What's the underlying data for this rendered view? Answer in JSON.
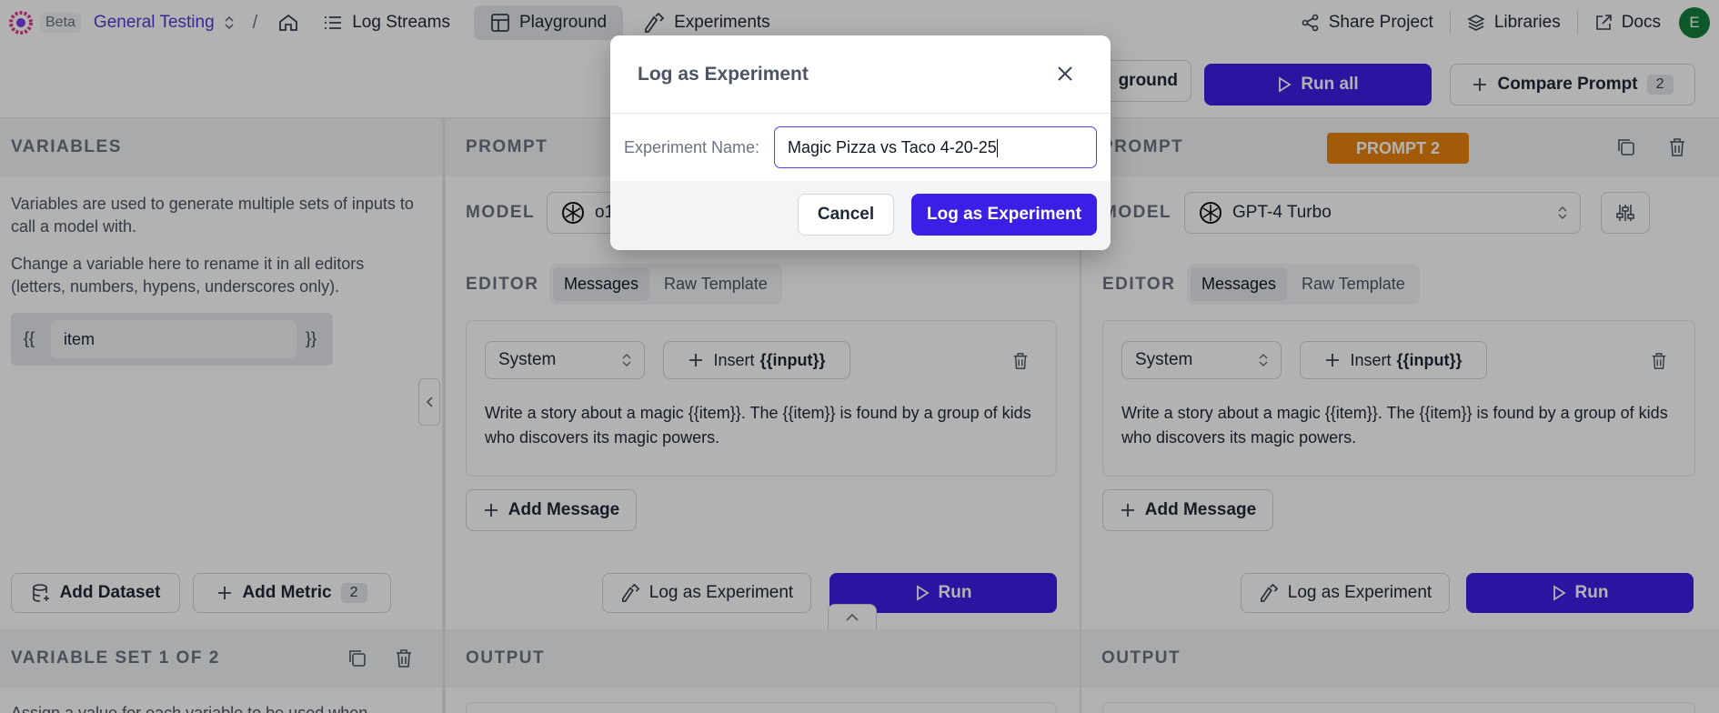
{
  "topbar": {
    "beta": "Beta",
    "project": "General Testing",
    "slash": "/",
    "nav": [
      {
        "label": "Log Streams"
      },
      {
        "label": "Playground"
      },
      {
        "label": "Experiments"
      }
    ],
    "share": "Share Project",
    "libraries": "Libraries",
    "docs": "Docs",
    "avatar": "E"
  },
  "toolbar": {
    "clear_partial": "ground",
    "run_all": "Run all",
    "compare_prompt": "Compare Prompt",
    "compare_count": "2"
  },
  "variables": {
    "header": "VARIABLES",
    "help1": "Variables are used to generate multiple sets of inputs to call a model with.",
    "help2": "Change a variable here to rename it in all editors (letters, numbers, hypens, underscores only).",
    "open": "{{",
    "close": "}}",
    "variable_value": "item",
    "add_dataset": "Add Dataset",
    "add_metric": "Add Metric",
    "metric_count": "2",
    "set_header": "VARIABLE SET 1 OF 2",
    "set_help": "Assign a value for each variable to be used when"
  },
  "prompt1": {
    "header": "PROMPT",
    "model_label": "MODEL",
    "model_value": "o1",
    "editor_label": "EDITOR",
    "tab_messages": "Messages",
    "tab_raw": "Raw Template",
    "role": "System",
    "insert": "Insert",
    "insert_token": "{{input}}",
    "text": "Write a story about a magic {{item}}. The {{item}} is found by a group of kids who discovers its magic powers.",
    "add_message": "Add Message",
    "log_experiment": "Log as Experiment",
    "run": "Run",
    "output_header": "OUTPUT"
  },
  "prompt2": {
    "header": "PROMPT",
    "badge": "PROMPT 2",
    "model_label": "MODEL",
    "model_value": "GPT-4 Turbo",
    "editor_label": "EDITOR",
    "tab_messages": "Messages",
    "tab_raw": "Raw Template",
    "role": "System",
    "insert": "Insert",
    "insert_token": "{{input}}",
    "text": "Write a story about a magic {{item}}. The {{item}} is found by a group of kids who discovers its magic powers.",
    "add_message": "Add Message",
    "log_experiment": "Log as Experiment",
    "run": "Run",
    "output_header": "OUTPUT"
  },
  "modal": {
    "title": "Log as Experiment",
    "field_label": "Experiment Name:",
    "field_value": "Magic Pizza vs Taco 4-20-25",
    "cancel": "Cancel",
    "submit": "Log as Experiment"
  },
  "colors": {
    "primary": "#3b1fe6",
    "project_link": "#4f3bd6",
    "badge_orange": "#e8830c"
  }
}
